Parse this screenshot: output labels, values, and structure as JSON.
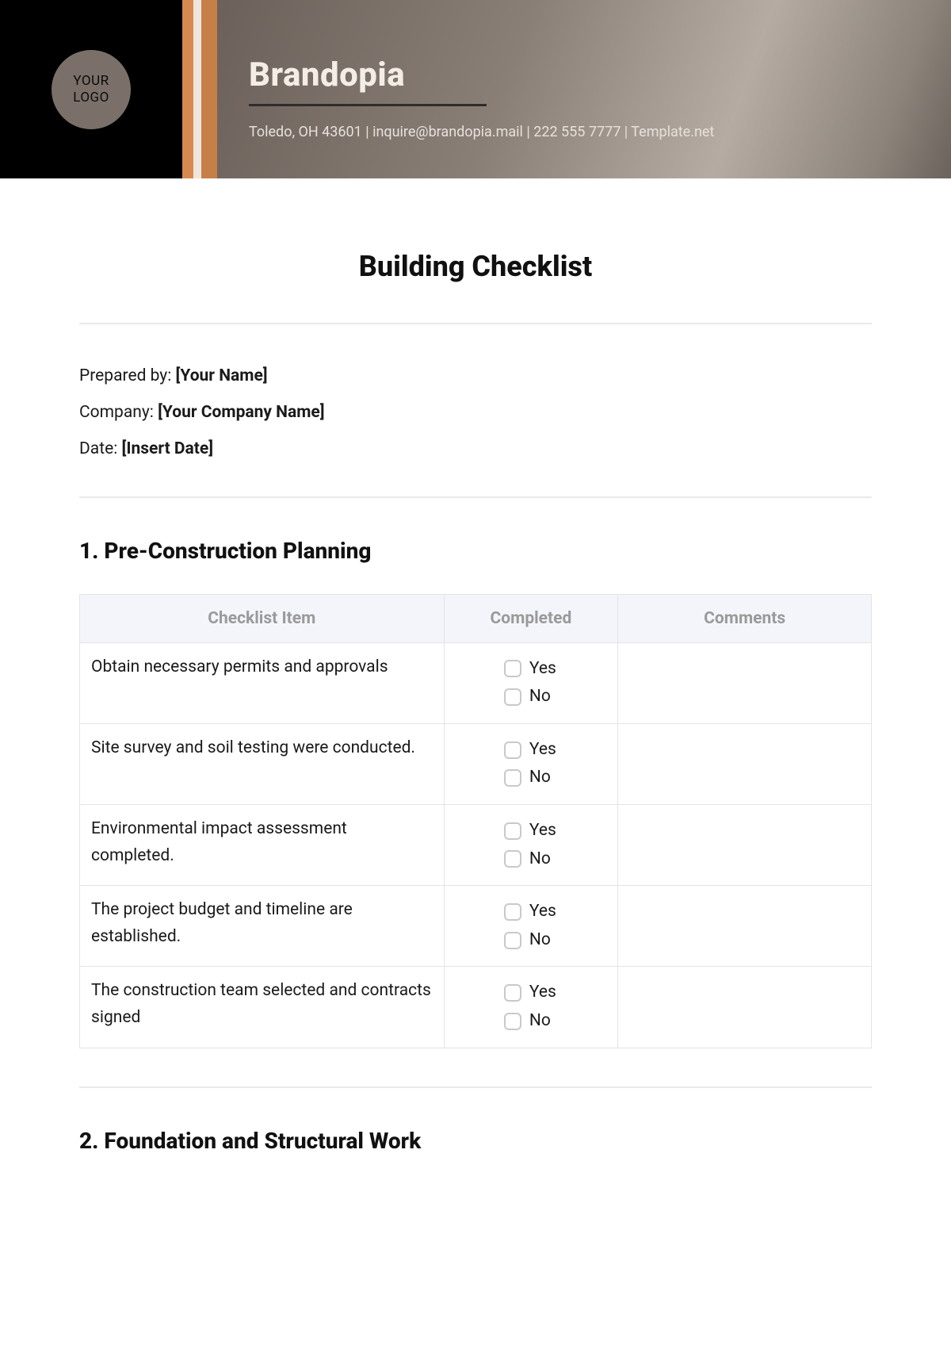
{
  "header": {
    "logo_line1": "YOUR",
    "logo_line2": "LOGO",
    "brand": "Brandopia",
    "contact": "Toledo, OH 43601 | inquire@brandopia.mail | 222 555 7777 | Template.net",
    "stripes": [
      "#d68a52",
      "#eee6dc",
      "#c77f48"
    ]
  },
  "doc": {
    "title": "Building Checklist",
    "meta": {
      "prepared_label": "Prepared by: ",
      "prepared_value": "[Your Name]",
      "company_label": "Company: ",
      "company_value": "[Your Company Name]",
      "date_label": "Date: ",
      "date_value": "[Insert Date]"
    }
  },
  "table_headers": {
    "item": "Checklist Item",
    "completed": "Completed",
    "comments": "Comments"
  },
  "yn": {
    "yes": "Yes",
    "no": "No"
  },
  "sections": [
    {
      "title": "1. Pre-Construction Planning",
      "rows": [
        {
          "item": "Obtain necessary permits and approvals",
          "comments": ""
        },
        {
          "item": "Site survey and soil testing were conducted.",
          "comments": ""
        },
        {
          "item": "Environmental impact assessment completed.",
          "comments": ""
        },
        {
          "item": "The project budget and timeline are established.",
          "comments": ""
        },
        {
          "item": "The construction team selected and contracts signed",
          "comments": ""
        }
      ]
    },
    {
      "title": "2. Foundation and Structural Work",
      "rows": []
    }
  ]
}
